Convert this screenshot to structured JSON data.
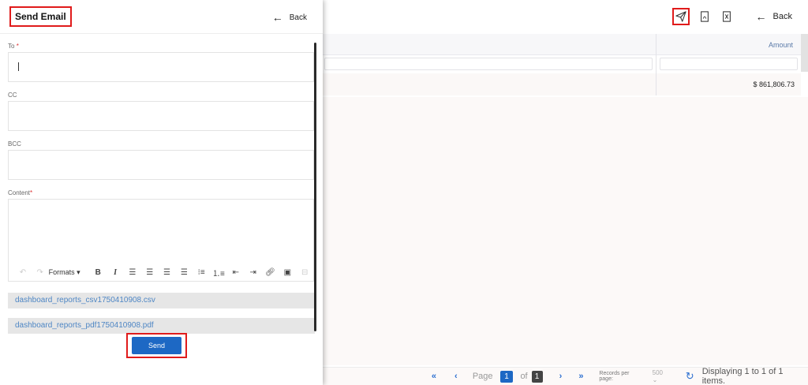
{
  "panel": {
    "title": "Send Email",
    "back_label": "Back",
    "fields": {
      "to_label": "To",
      "to_required": "*",
      "cc_label": "CC",
      "bcc_label": "BCC",
      "content_label": "Content",
      "content_required": "*"
    },
    "toolbar": {
      "formats_label": "Formats ▾",
      "bold": "B",
      "italic": "I"
    },
    "attachments": [
      "dashboard_reports_csv1750410908.csv",
      "dashboard_reports_pdf1750410908.pdf"
    ],
    "send_label": "Send"
  },
  "background": {
    "back_label": "Back",
    "grid": {
      "amount_header": "Amount",
      "amount_value": "$ 861,806.73"
    },
    "pager": {
      "page_label": "Page",
      "current_page": "1",
      "of_label": "of",
      "total_pages": "1",
      "records_per_page_label": "Records per page:",
      "records_per_page_value": "500",
      "display_text": "Displaying 1 to 1 of 1 items."
    }
  },
  "colors": {
    "accent": "#1d68c4",
    "highlight": "#e01b1b",
    "link": "#4e86c4"
  },
  "icons": [
    "send-icon",
    "pdf-icon",
    "excel-icon",
    "back-arrow-icon",
    "refresh-icon"
  ]
}
